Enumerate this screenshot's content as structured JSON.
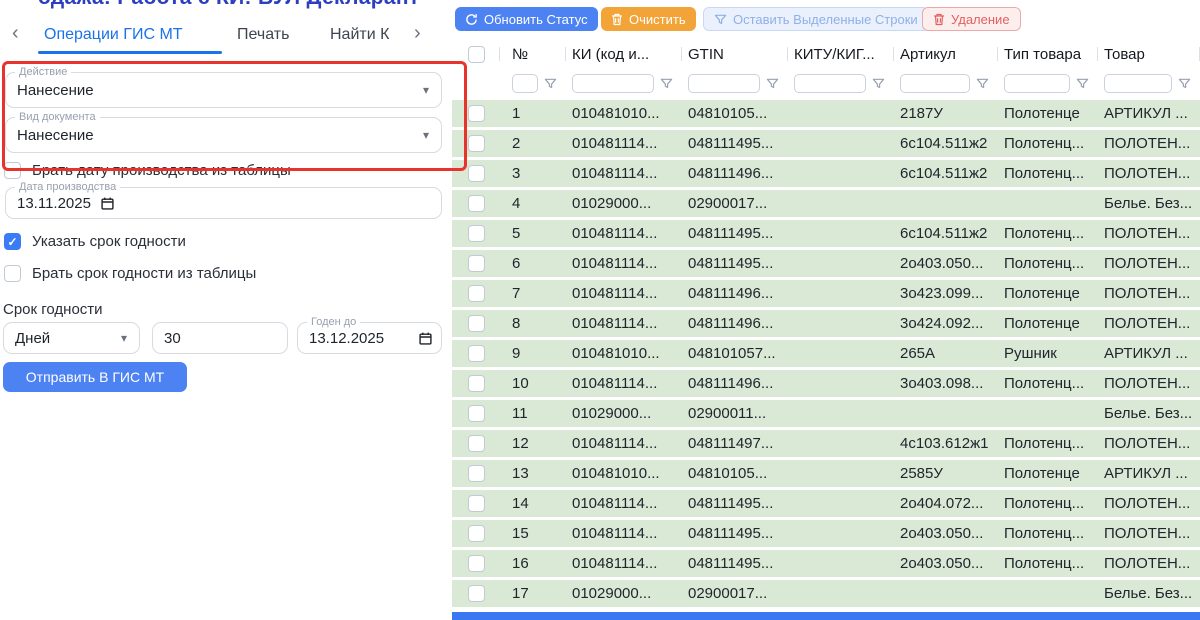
{
  "header": {
    "title_partial": "одажа! Работа с КИ! БУЛ Декларант",
    "toolbar": {
      "refresh_status": "Обновить Статус",
      "clear": "Очистить",
      "keep_selected": "Оставить Выделенные Строки",
      "delete": "Удаление"
    }
  },
  "icons": {
    "caret": "▾",
    "back": "‹",
    "forward": "›",
    "check": "✓"
  },
  "panel": {
    "tabs": [
      {
        "label": "Операции ГИС МТ",
        "active": true
      },
      {
        "label": "Печать",
        "active": false
      },
      {
        "label": "Найти К",
        "active": false
      }
    ],
    "action_field": {
      "label": "Действие",
      "value": "Нанесение"
    },
    "doc_type_field": {
      "label": "Вид документа",
      "value": "Нанесение"
    },
    "take_prod_date_checkbox": {
      "label": "Брать дату производства из таблицы",
      "checked": false
    },
    "production_date_field": {
      "label": "Дата производства",
      "value": "13.11.2025"
    },
    "set_shelf_life_checkbox": {
      "label": "Указать срок годности",
      "checked": true
    },
    "take_shelf_life_checkbox": {
      "label": "Брать срок годности из таблицы",
      "checked": false
    },
    "shelf_life_section_label": "Срок годности",
    "shelf_life_unit_field": {
      "value": "Дней"
    },
    "shelf_life_value_field": {
      "value": "30"
    },
    "valid_until_field": {
      "label": "Годен до",
      "value": "13.12.2025"
    },
    "submit_button": "Отправить В ГИС МТ"
  },
  "table": {
    "columns": [
      "№",
      "КИ (код и...",
      "GTIN",
      "КИТУ/КИГ...",
      "Артикул",
      "Тип товара",
      "Товар"
    ],
    "rows": [
      {
        "n": "1",
        "ki": "010481010...",
        "gtin": "04810105...",
        "kitu": "",
        "article": "2187У",
        "type": "Полотенце",
        "product": "АРТИКУЛ ..."
      },
      {
        "n": "2",
        "ki": "010481114...",
        "gtin": "048111495...",
        "kitu": "",
        "article": "6с104.511ж2",
        "type": "Полотенц...",
        "product": "ПОЛОТЕН..."
      },
      {
        "n": "3",
        "ki": "010481114...",
        "gtin": "048111496...",
        "kitu": "",
        "article": "6с104.511ж2",
        "type": "Полотенц...",
        "product": "ПОЛОТЕН..."
      },
      {
        "n": "4",
        "ki": "01029000...",
        "gtin": "02900017...",
        "kitu": "",
        "article": "",
        "type": "",
        "product": "Белье. Без..."
      },
      {
        "n": "5",
        "ki": "010481114...",
        "gtin": "048111495...",
        "kitu": "",
        "article": "6с104.511ж2",
        "type": "Полотенц...",
        "product": "ПОЛОТЕН..."
      },
      {
        "n": "6",
        "ki": "010481114...",
        "gtin": "048111495...",
        "kitu": "",
        "article": "2о403.050...",
        "type": "Полотенц...",
        "product": "ПОЛОТЕН..."
      },
      {
        "n": "7",
        "ki": "010481114...",
        "gtin": "048111496...",
        "kitu": "",
        "article": "3о423.099...",
        "type": "Полотенце",
        "product": "ПОЛОТЕН..."
      },
      {
        "n": "8",
        "ki": "010481114...",
        "gtin": "048111496...",
        "kitu": "",
        "article": "3о424.092...",
        "type": "Полотенце",
        "product": "ПОЛОТЕН..."
      },
      {
        "n": "9",
        "ki": "010481010...",
        "gtin": "048101057...",
        "kitu": "",
        "article": "265А",
        "type": "Рушник",
        "product": "АРТИКУЛ ..."
      },
      {
        "n": "10",
        "ki": "010481114...",
        "gtin": "048111496...",
        "kitu": "",
        "article": "3о403.098...",
        "type": "Полотенц...",
        "product": "ПОЛОТЕН..."
      },
      {
        "n": "11",
        "ki": "01029000...",
        "gtin": "02900011...",
        "kitu": "",
        "article": "",
        "type": "",
        "product": "Белье. Без..."
      },
      {
        "n": "12",
        "ki": "010481114...",
        "gtin": "048111497...",
        "kitu": "",
        "article": "4с103.612ж1",
        "type": "Полотенц...",
        "product": "ПОЛОТЕН..."
      },
      {
        "n": "13",
        "ki": "010481010...",
        "gtin": "04810105...",
        "kitu": "",
        "article": "2585У",
        "type": "Полотенце",
        "product": "АРТИКУЛ ..."
      },
      {
        "n": "14",
        "ki": "010481114...",
        "gtin": "048111495...",
        "kitu": "",
        "article": "2о404.072...",
        "type": "Полотенц...",
        "product": "ПОЛОТЕН..."
      },
      {
        "n": "15",
        "ki": "010481114...",
        "gtin": "048111495...",
        "kitu": "",
        "article": "2о403.050...",
        "type": "Полотенц...",
        "product": "ПОЛОТЕН..."
      },
      {
        "n": "16",
        "ki": "010481114...",
        "gtin": "048111495...",
        "kitu": "",
        "article": "2о403.050...",
        "type": "Полотенц...",
        "product": "ПОЛОТЕН..."
      },
      {
        "n": "17",
        "ki": "01029000...",
        "gtin": "02900017...",
        "kitu": "",
        "article": "",
        "type": "",
        "product": "Белье. Без..."
      }
    ]
  },
  "colors": {
    "accent_blue": "#4d82f3",
    "tab_blue": "#1a73e8",
    "orange": "#f2a438",
    "danger_red": "#e36060",
    "annotation_red": "#e8332c",
    "row_green": "#d9e9d5",
    "selection_blue": "#3a78f2"
  }
}
